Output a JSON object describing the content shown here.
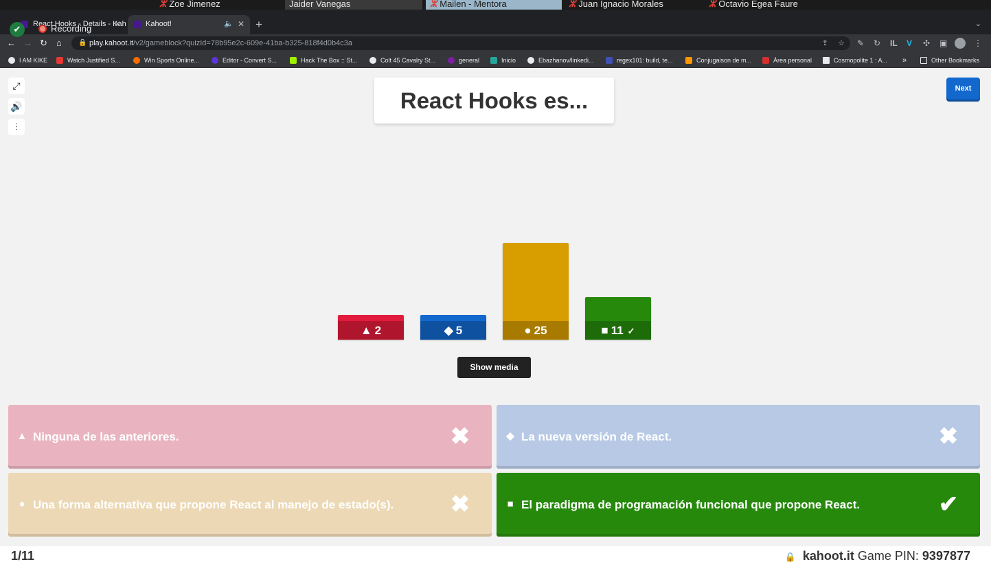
{
  "zoom": {
    "participants": [
      "Zoe Jimenez",
      "Jaider Vanegas",
      "Mailen - Mentora",
      "Juan Ignacio Morales",
      "Octavio Egea Faure"
    ]
  },
  "browser": {
    "tabs": [
      {
        "title": "React Hooks - Details - Kahoot"
      },
      {
        "title": "Kahoot!"
      }
    ],
    "recording_label": "Recording",
    "url_host": "play.kahoot.it",
    "url_path": "/v2/gameblock?quizId=78b95e2c-609e-41ba-b325-818f4d0b4c3a",
    "bookmarks": [
      "I AM KIKE",
      "Watch Justified S...",
      "Win Sports Online...",
      "Editor - Convert S...",
      "Hack The Box :: St...",
      "Colt 45 Cavalry St...",
      "general",
      "Inicio",
      "Ebazhanov/linkedi...",
      "regex101: build, te...",
      "Conjugaison de m...",
      "Área personal",
      "Cosmopolite 1 : A..."
    ],
    "bookmarks_more": "»",
    "other_bookmarks": "Other Bookmarks"
  },
  "kahoot": {
    "question": "React Hooks es...",
    "next_label": "Next",
    "show_media_label": "Show media",
    "results": [
      {
        "shape": "▲",
        "count": "2",
        "value": 2,
        "color": "#e21b3c",
        "correct": false
      },
      {
        "shape": "◆",
        "count": "5",
        "value": 5,
        "color": "#1368ce",
        "correct": false
      },
      {
        "shape": "●",
        "count": "25",
        "value": 25,
        "color": "#d89e00",
        "correct": false
      },
      {
        "shape": "■",
        "count": "11",
        "value": 11,
        "color": "#26890c",
        "correct": true
      }
    ],
    "answers": [
      {
        "shape": "▲",
        "text": "Ninguna de las anteriores.",
        "correct": false
      },
      {
        "shape": "◆",
        "text": "La nueva versión de React.",
        "correct": false
      },
      {
        "shape": "●",
        "text": "Una forma alternativa que propone React al manejo de estado(s).",
        "correct": false
      },
      {
        "shape": "■",
        "text": "El paradigma de programación funcional que propone React.",
        "correct": true
      }
    ],
    "footer": {
      "question_count": "1/11",
      "site": "kahoot.it",
      "pin_label": "Game PIN:",
      "pin": "9397877"
    }
  },
  "colors": {
    "answer_red_faded": "#e9b3c0",
    "answer_blue_faded": "#b7c9e5",
    "answer_yellow_faded": "#ecd8b4",
    "answer_green": "#26890c"
  }
}
